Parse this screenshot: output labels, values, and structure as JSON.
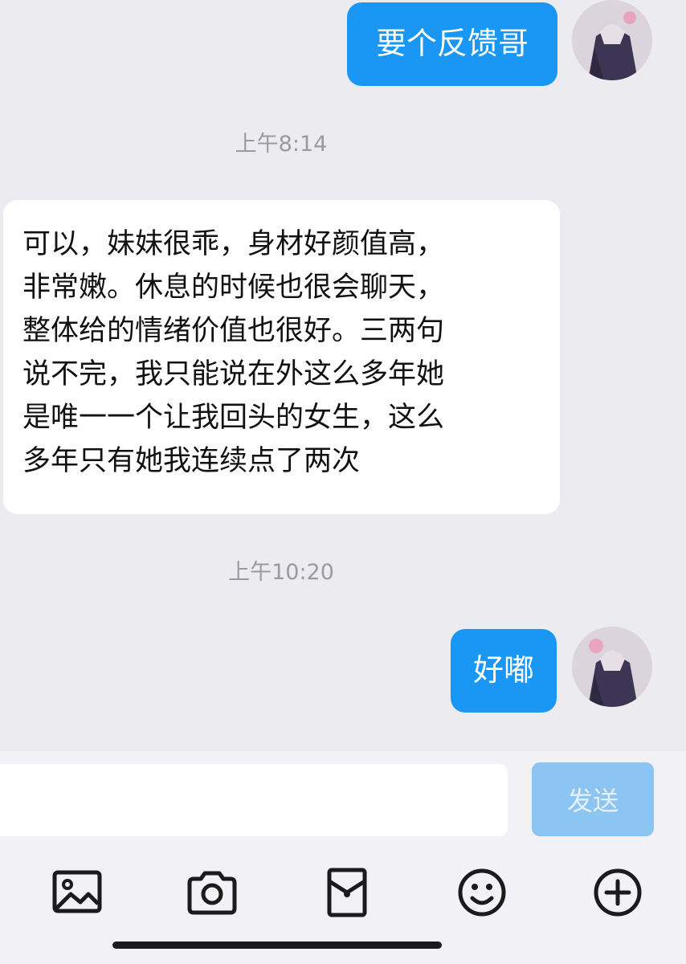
{
  "messages": [
    {
      "sender": "me",
      "text": "要个反馈哥"
    },
    {
      "timestamp": "上午8:14"
    },
    {
      "sender": "them",
      "lines": [
        "可以，妹妹很乖，身材好颜值高，",
        "非常嫩。休息的时候也很会聊天，",
        "整体给的情绪价值也很好。三两句",
        "说不完，我只能说在外这么多年她",
        "是唯一一个让我回头的女生，这么",
        "多年只有她我连续点了两次"
      ]
    },
    {
      "timestamp": "上午10:20"
    },
    {
      "sender": "me",
      "text": "好嘟"
    }
  ],
  "input": {
    "value": "",
    "send_label": "发送"
  },
  "toolbar": {
    "icons": [
      "image-icon",
      "camera-icon",
      "red-envelope-icon",
      "emoji-icon",
      "plus-icon"
    ]
  },
  "colors": {
    "my_bubble": "#1a97f5",
    "their_bubble": "#ffffff",
    "background": "#ececf0",
    "send_disabled": "#8cc5f2"
  }
}
